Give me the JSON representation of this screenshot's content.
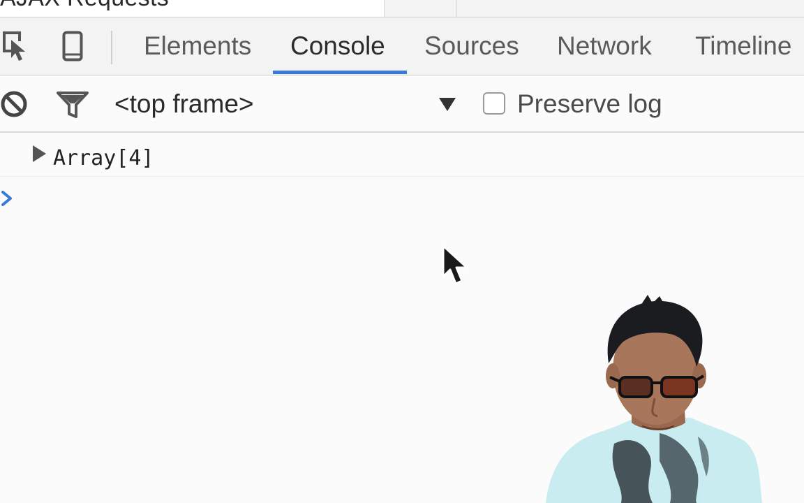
{
  "page": {
    "title": "AJAX Requests"
  },
  "devtools": {
    "tabs": [
      {
        "label": "Elements"
      },
      {
        "label": "Console"
      },
      {
        "label": "Sources"
      },
      {
        "label": "Network"
      },
      {
        "label": "Timeline"
      }
    ],
    "active_tab": "Console",
    "accent_color": "#3879d9"
  },
  "console_toolbar": {
    "frame_select": "<top frame>",
    "preserve_log_label": "Preserve log",
    "preserve_log_checked": false
  },
  "console_output": {
    "entries": [
      {
        "text": "Array[4]",
        "expanded": false
      }
    ],
    "prompt_symbol_color": "#3879d9"
  },
  "icons": {
    "inspect": "inspect-element-icon",
    "device": "device-mode-icon",
    "clear": "clear-console-icon",
    "filter": "filter-icon",
    "dropdown": "dropdown-arrow-icon",
    "expand": "expand-arrow-icon",
    "prompt": "console-prompt-icon",
    "cursor": "mouse-cursor-icon"
  }
}
